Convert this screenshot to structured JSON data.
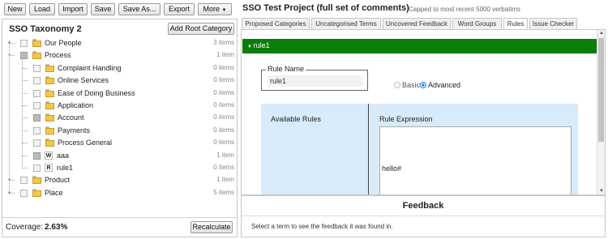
{
  "toolbar": {
    "new": "New",
    "load": "Load",
    "import": "Import",
    "save": "Save",
    "save_as": "Save As...",
    "export": "Export",
    "more": "More"
  },
  "taxonomy": {
    "title": "SSO Taxonomy 2",
    "add_root": "Add Root Category",
    "items": [
      {
        "label": "Our People",
        "count": "3 items"
      },
      {
        "label": "Process",
        "count": "1 item"
      },
      {
        "label": "Complaint Handling",
        "count": "0 items"
      },
      {
        "label": "Online Services",
        "count": "0 items"
      },
      {
        "label": "Ease of Doing Business",
        "count": "0 items"
      },
      {
        "label": "Application",
        "count": "0 items"
      },
      {
        "label": "Account",
        "count": "0 items"
      },
      {
        "label": "Payments",
        "count": "0 items"
      },
      {
        "label": "Process General",
        "count": "0 items"
      },
      {
        "label": "aaa",
        "count": "1 item",
        "letter": "W"
      },
      {
        "label": "rule1",
        "count": "0 items",
        "letter": "R"
      },
      {
        "label": "Product",
        "count": "1 item"
      },
      {
        "label": "Place",
        "count": "5 items"
      }
    ],
    "coverage_label": "Coverage:",
    "coverage_value": "2.63%",
    "recalculate": "Recalculate"
  },
  "project": {
    "title": "SSO Test Project (full set of comments)",
    "subtitle": "Capped to most recent 5000 verbatims"
  },
  "tabs": [
    "Proposed Categories",
    "Uncategorised Terms",
    "Uncovered Feedback",
    "Word Groups",
    "Rules",
    "Issue Checker"
  ],
  "rule": {
    "header": "rule1",
    "name_legend": "Rule Name",
    "name_value": "rule1",
    "basic": "Basic",
    "advanced": "Advanced",
    "available_rules": "Available Rules",
    "expression_label": "Rule Expression",
    "expression_value": "hello#"
  },
  "feedback": {
    "title": "Feedback",
    "hint": "Select a term to see the feedback it was found in."
  },
  "colors": {
    "header_green": "#0a7d0a",
    "rules_bg": "#d7ebfa"
  }
}
